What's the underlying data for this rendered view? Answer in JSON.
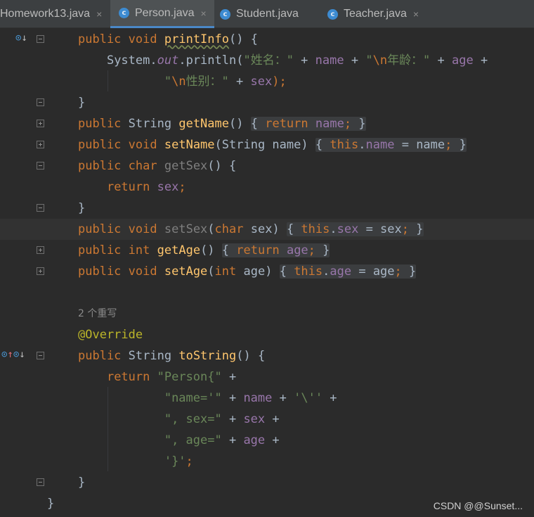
{
  "tabs": [
    {
      "label": "Homework13.java",
      "active": false
    },
    {
      "label": "Person.java",
      "active": true
    },
    {
      "label": "Student.java",
      "active": false
    },
    {
      "label": "Teacher.java",
      "active": false
    }
  ],
  "tab_icon_letter": "c",
  "tab_close": "×",
  "code": {
    "l1": {
      "kw1": "public",
      "kw2": "void",
      "fn": "printInfo",
      "rest": "() {"
    },
    "l2": {
      "cls": "System.",
      "fld": "out",
      "call": ".println(",
      "s1": "\"姓名：\"",
      "p1": " + ",
      "f1": "name",
      "p2": " + ",
      "s2": "\"",
      "e1": "\\n",
      "s3": "年龄：\"",
      "p3": " + ",
      "f2": "age",
      "p4": " +"
    },
    "l3": {
      "s1": "\"",
      "e1": "\\n",
      "s2": "性别：\"",
      "p1": " + ",
      "f1": "sex",
      "end": ");"
    },
    "l4": {
      "brace": "}"
    },
    "l5": {
      "kw1": "public",
      "type": "String",
      "fn": "getName",
      "paren": "()",
      "ob": "{ ",
      "kw2": "return",
      "f1": "name",
      "semi": ";",
      "cb": " }"
    },
    "l6": {
      "kw1": "public",
      "kw2": "void",
      "fn": "setName",
      "p1": "(String name)",
      "ob": "{ ",
      "th": "this",
      "dot": ".",
      "f1": "name",
      "eq": " = name",
      "semi": ";",
      "cb": " }"
    },
    "l7": {
      "kw1": "public",
      "kw2": "char",
      "fn": "getSex",
      "rest": "() {"
    },
    "l8": {
      "kw1": "return",
      "f1": "sex",
      "semi": ";"
    },
    "l9": {
      "brace": "}"
    },
    "l10": {
      "kw1": "public",
      "kw2": "void",
      "fn": "setSex",
      "p0": "(",
      "kw3": "char",
      "p1": " sex)",
      "ob": "{ ",
      "th": "this",
      "dot": ".",
      "f1": "sex",
      "eq": " = sex",
      "semi": ";",
      "cb": " }"
    },
    "l11": {
      "kw1": "public",
      "kw2": "int",
      "fn": "getAge",
      "paren": "()",
      "ob": "{ ",
      "kw3": "return",
      "f1": "age",
      "semi": ";",
      "cb": " }"
    },
    "l12": {
      "kw1": "public",
      "kw2": "void",
      "fn": "setAge",
      "p0": "(",
      "kw3": "int",
      "p1": " age)",
      "ob": "{ ",
      "th": "this",
      "dot": ".",
      "f1": "age",
      "eq": " = age",
      "semi": ";",
      "cb": " }"
    },
    "hint": "2 个重写",
    "ann": "@Override",
    "l15": {
      "kw1": "public",
      "type": "String",
      "fn": "toString",
      "rest": "() {"
    },
    "l16": {
      "kw1": "return",
      "s1": "\"Person{\"",
      "plus": " +"
    },
    "l17": {
      "s1": "\"name='\"",
      "p1": " + ",
      "f1": "name",
      "p2": " + ",
      "s2": "'\\''",
      "plus": " +"
    },
    "l18": {
      "s1": "\", sex=\"",
      "p1": " + ",
      "f1": "sex",
      "plus": " +"
    },
    "l19": {
      "s1": "\", age=\"",
      "p1": " + ",
      "f1": "age",
      "plus": " +"
    },
    "l20": {
      "s1": "'}'",
      "semi": ";"
    },
    "l21": {
      "brace": "}"
    },
    "l22": {
      "brace": "}"
    }
  },
  "watermark": "CSDN @@Sunset...",
  "colors": {
    "keyword": "#cc7832",
    "function": "#ffc66d",
    "string": "#6a8759",
    "field": "#9876aa",
    "annotation": "#bbb529",
    "text": "#a9b7c6",
    "background": "#2b2b2b"
  }
}
